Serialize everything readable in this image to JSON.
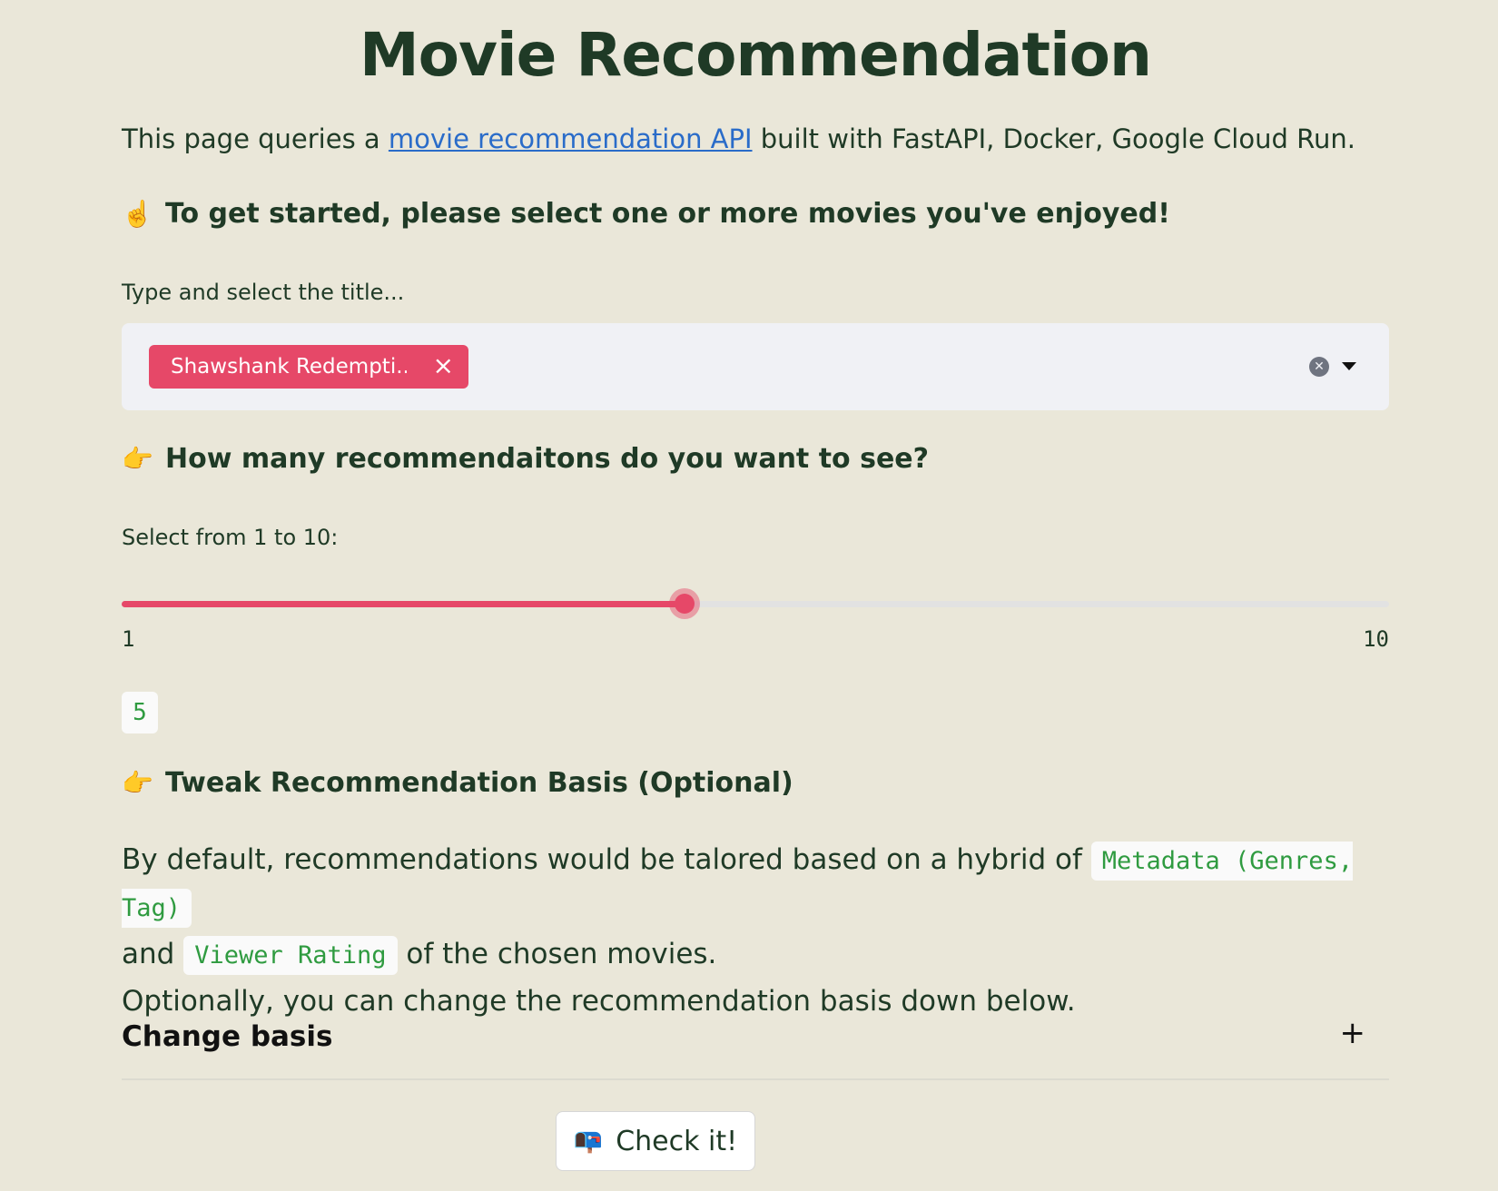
{
  "page": {
    "title": "Movie Recommendation"
  },
  "intro": {
    "prefix": "This page queries a ",
    "link_text": "movie recommendation API",
    "suffix": " built with FastAPI, Docker, Google Cloud Run."
  },
  "section1": {
    "emoji": "☝️",
    "heading": "To get started, please select one or more movies you've enjoyed!",
    "select_label": "Type and select the title...",
    "selected_tags": [
      "Shawshank Redempti..."
    ],
    "tag_remove_icon": "×"
  },
  "section2": {
    "emoji": "👉",
    "heading": "How many recommendaitons do you want to see?",
    "slider_label": "Select from 1 to 10:",
    "min": "1",
    "max": "10",
    "value": "5"
  },
  "section3": {
    "emoji": "👉",
    "heading": "Tweak Recommendation Basis (Optional)",
    "para_part1": "By default, recommendations would be talored based on a hybrid of ",
    "code1": "Metadata (Genres, Tag)",
    "para_part2": " and ",
    "code2": "Viewer Rating",
    "para_part3": " of the chosen movies.",
    "para_line2": "Optionally, you can change the recommendation basis down below."
  },
  "expander": {
    "label": "Change basis",
    "icon": "+"
  },
  "button": {
    "emoji": "📭",
    "label": "Check it!"
  },
  "colors": {
    "accent": "#e64868",
    "background": "#eae7d9",
    "text": "#1f3a26",
    "code_text": "#2f9b40",
    "link": "#2a6cc9"
  }
}
